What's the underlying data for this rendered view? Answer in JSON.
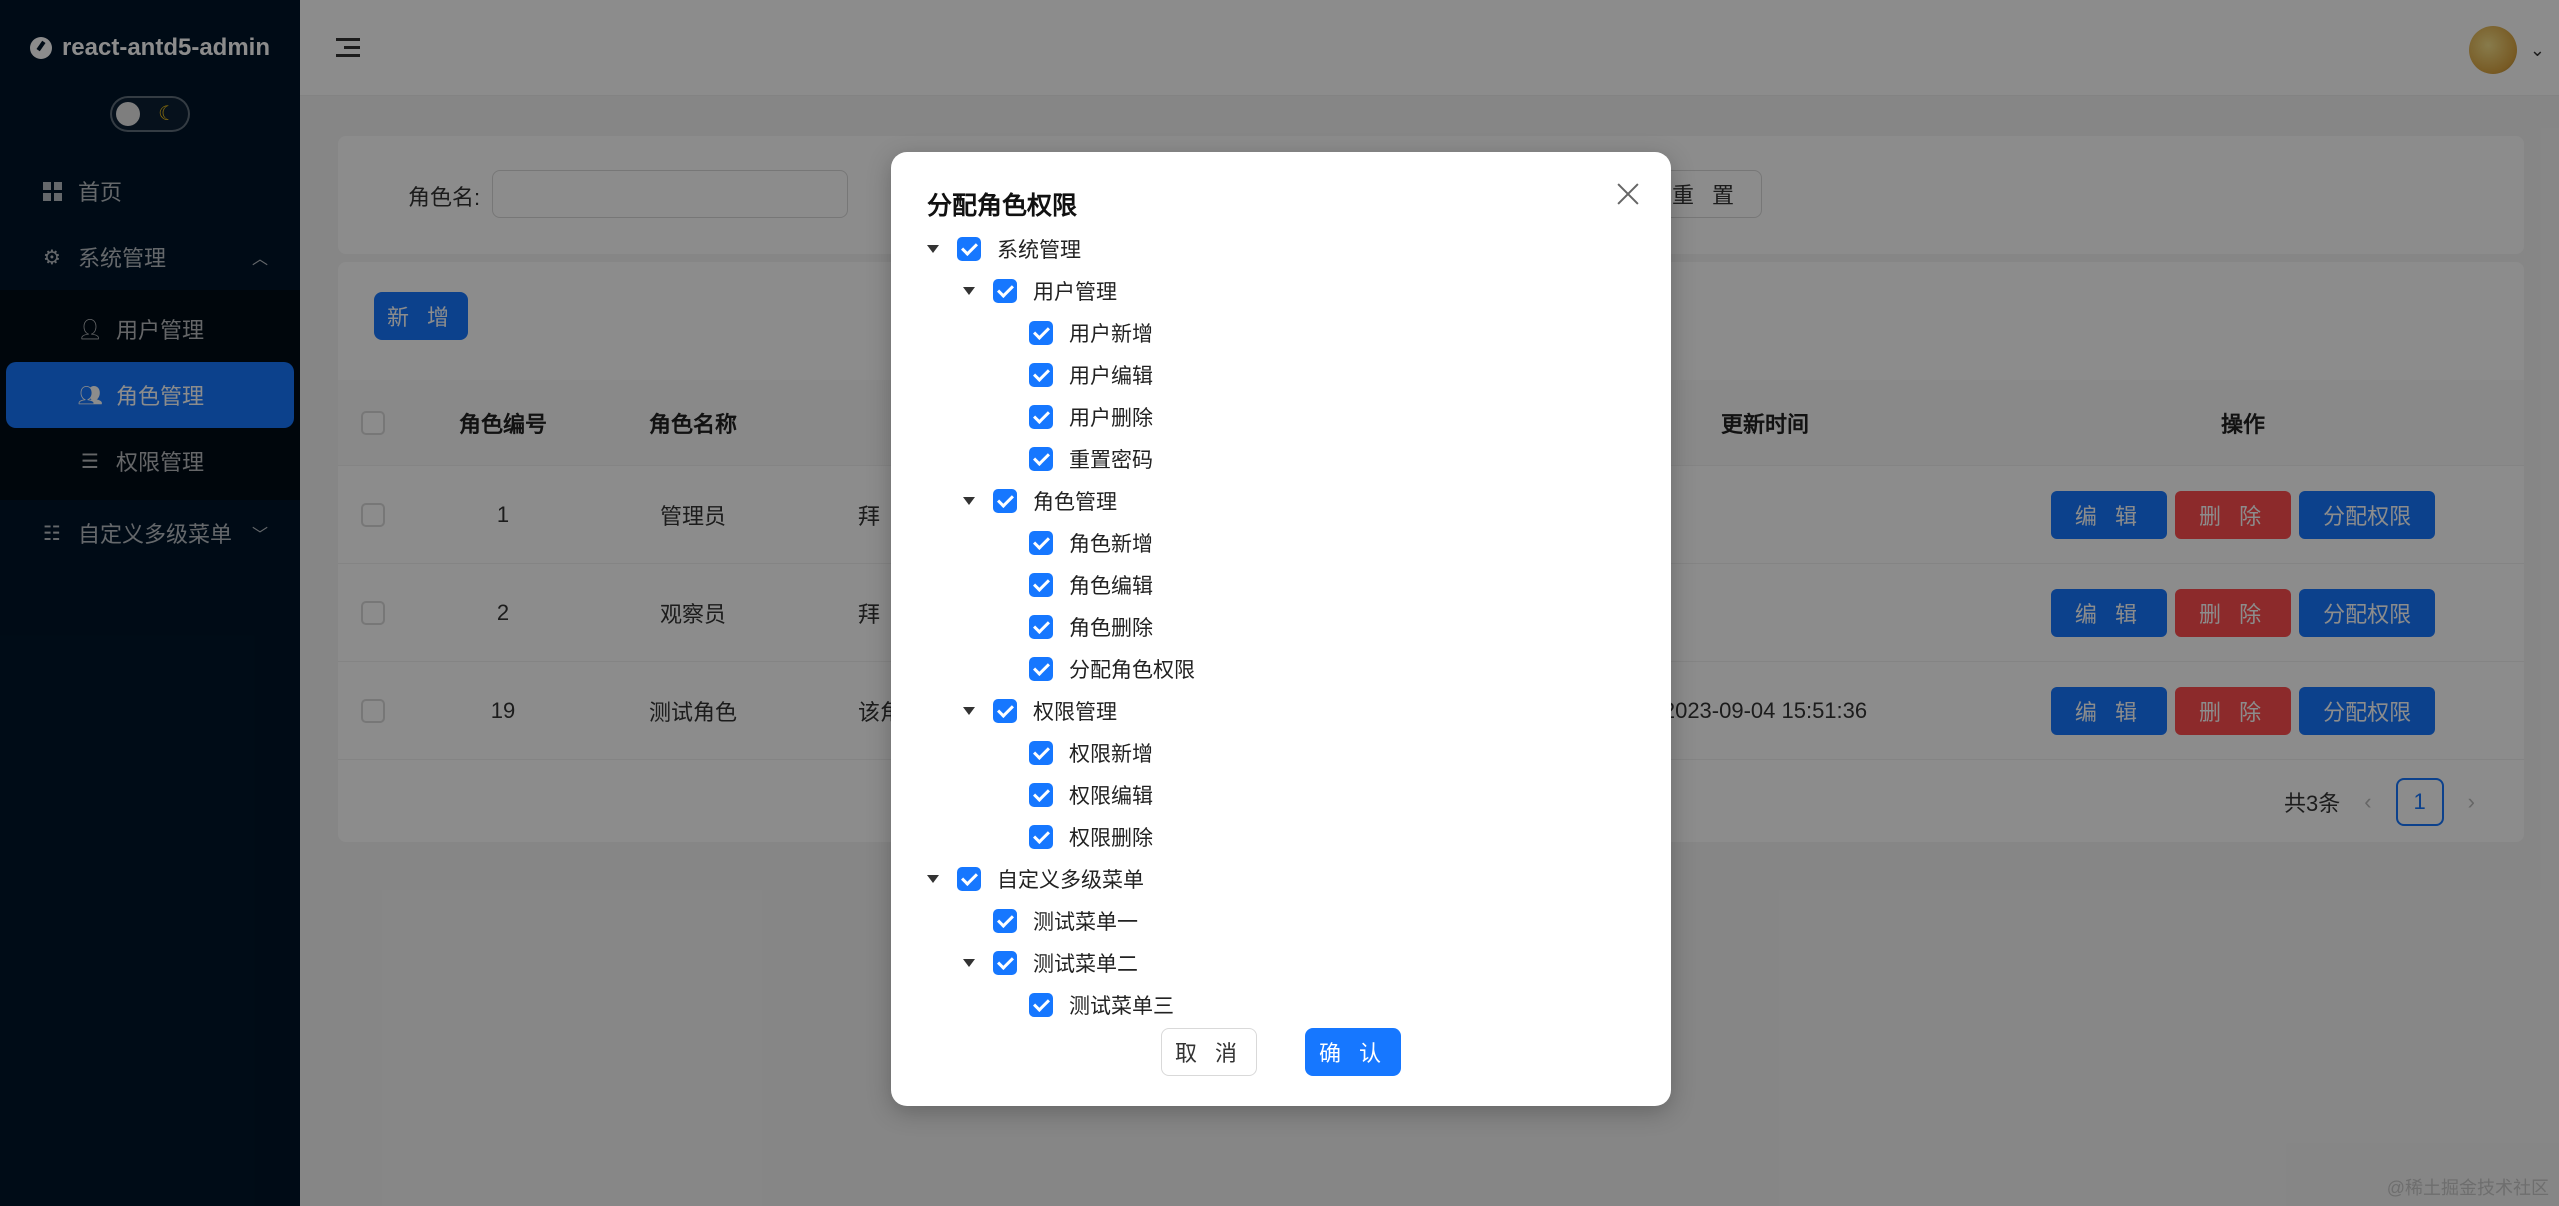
{
  "app": {
    "title": "react-antd5-admin"
  },
  "sidebar": {
    "items": [
      {
        "label": "首页"
      },
      {
        "label": "系统管理"
      },
      {
        "label": "用户管理"
      },
      {
        "label": "角色管理"
      },
      {
        "label": "权限管理"
      },
      {
        "label": "自定义多级菜单"
      }
    ]
  },
  "search": {
    "label": "角色名:",
    "reset_label": "重 置"
  },
  "toolbar": {
    "add_label": "新 增"
  },
  "table": {
    "columns": [
      "角色编号",
      "角色名称",
      "更新时间",
      "操作"
    ],
    "rows": [
      {
        "id": "1",
        "name": "管理员",
        "desc": "拜",
        "updated": ""
      },
      {
        "id": "2",
        "name": "观察员",
        "desc": "拜",
        "updated": ""
      },
      {
        "id": "19",
        "name": "测试角色",
        "desc": "该角",
        "updated": "2023-09-04 15:51:36"
      }
    ],
    "actions": {
      "edit": "编 辑",
      "delete": "删 除",
      "assign": "分配权限"
    }
  },
  "pagination": {
    "total_label": "共3条",
    "current_page": "1"
  },
  "modal": {
    "title": "分配角色权限",
    "tree": [
      {
        "label": "系统管理",
        "level": 0,
        "expandable": true,
        "checked": true
      },
      {
        "label": "用户管理",
        "level": 1,
        "expandable": true,
        "checked": true
      },
      {
        "label": "用户新增",
        "level": 2,
        "expandable": false,
        "checked": true
      },
      {
        "label": "用户编辑",
        "level": 2,
        "expandable": false,
        "checked": true
      },
      {
        "label": "用户删除",
        "level": 2,
        "expandable": false,
        "checked": true
      },
      {
        "label": "重置密码",
        "level": 2,
        "expandable": false,
        "checked": true
      },
      {
        "label": "角色管理",
        "level": 1,
        "expandable": true,
        "checked": true
      },
      {
        "label": "角色新增",
        "level": 2,
        "expandable": false,
        "checked": true
      },
      {
        "label": "角色编辑",
        "level": 2,
        "expandable": false,
        "checked": true
      },
      {
        "label": "角色删除",
        "level": 2,
        "expandable": false,
        "checked": true
      },
      {
        "label": "分配角色权限",
        "level": 2,
        "expandable": false,
        "checked": true
      },
      {
        "label": "权限管理",
        "level": 1,
        "expandable": true,
        "checked": true
      },
      {
        "label": "权限新增",
        "level": 2,
        "expandable": false,
        "checked": true
      },
      {
        "label": "权限编辑",
        "level": 2,
        "expandable": false,
        "checked": true
      },
      {
        "label": "权限删除",
        "level": 2,
        "expandable": false,
        "checked": true
      },
      {
        "label": "自定义多级菜单",
        "level": 0,
        "expandable": true,
        "checked": true
      },
      {
        "label": "测试菜单一",
        "level": 1,
        "expandable": false,
        "checked": true
      },
      {
        "label": "测试菜单二",
        "level": 1,
        "expandable": true,
        "checked": true
      },
      {
        "label": "测试菜单三",
        "level": 2,
        "expandable": false,
        "checked": true
      }
    ],
    "cancel_label": "取 消",
    "ok_label": "确 认"
  },
  "watermark": "@稀土掘金技术社区",
  "colors": {
    "primary": "#1677ff",
    "danger": "#ff4d4f",
    "sidebar_bg": "#001529"
  }
}
